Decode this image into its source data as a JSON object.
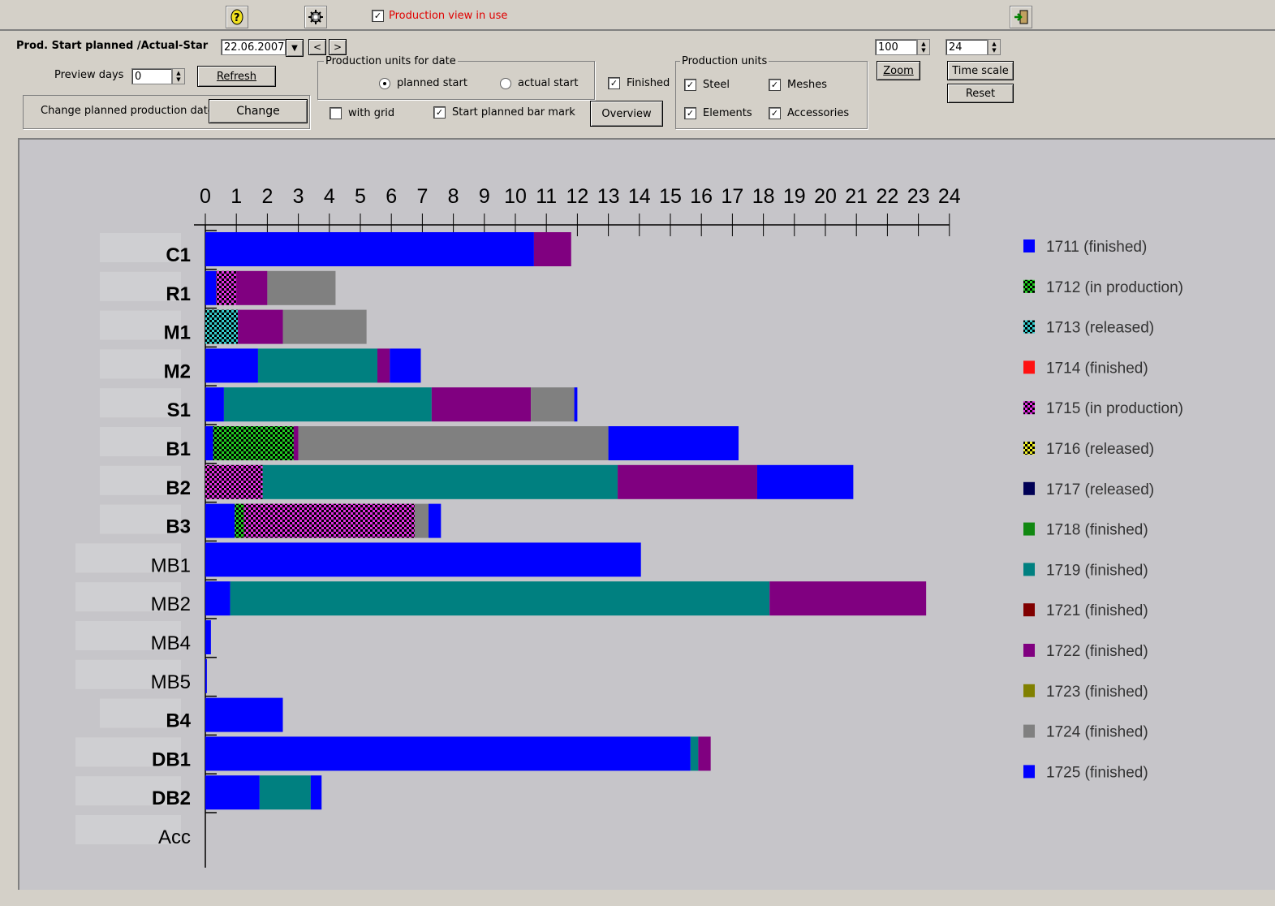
{
  "toolbar": {
    "production_view_label": "Production view in use",
    "production_view_checked": true
  },
  "controls": {
    "prod_start_label": "Prod. Start planned /Actual-Star",
    "date_value": "22.06.2007",
    "prev_label": "<",
    "next_label": ">",
    "preview_days_label": "Preview days",
    "preview_days_value": "0",
    "refresh_label": "Refresh",
    "change_date_label": "Change planned production date",
    "change_label": "Change",
    "prod_units_for_date_title": "Production units for date",
    "planned_start_label": "planned start",
    "actual_start_label": "actual start",
    "finished_label": "Finished",
    "with_grid_label": "with grid",
    "start_planned_bar_mark_label": "Start planned bar mark",
    "overview_label": "Overview",
    "prod_units_title": "Production units",
    "steel_label": "Steel",
    "meshes_label": "Meshes",
    "elements_label": "Elements",
    "accessories_label": "Accessories",
    "zoom_value": "100",
    "zoom_label": "Zoom",
    "time_scale_value": "24",
    "time_scale_label": "Time scale",
    "reset_label": "Reset"
  },
  "colors": {
    "1711": "#0000ff",
    "1712": "#22cc22",
    "1713": "#33cccc",
    "1714": "#ff1111",
    "1715": "#e030e0",
    "1716": "#eeee22",
    "1717": "#000055",
    "1718": "#118811",
    "1719": "#008080",
    "1721": "#800000",
    "1722": "#800080",
    "1723": "#808000",
    "1724": "#808080",
    "1725": "#0000ff"
  },
  "chart_data": {
    "type": "bar",
    "x_ticks": [
      "0",
      "1",
      "2",
      "3",
      "4",
      "5",
      "6",
      "7",
      "8",
      "9",
      "10",
      "11",
      "12",
      "13",
      "14",
      "15",
      "16",
      "17",
      "18",
      "19",
      "20",
      "21",
      "22",
      "23",
      "24"
    ],
    "xlim": [
      0,
      24
    ],
    "categories": [
      "C1",
      "R1",
      "M1",
      "M2",
      "S1",
      "B1",
      "B2",
      "B3",
      "MB1",
      "MB2",
      "MB4",
      "MB5",
      "B4",
      "DB1",
      "DB2",
      "Acc"
    ],
    "bold_categories": [
      "C1",
      "R1",
      "M1",
      "M2",
      "S1",
      "B1",
      "B2",
      "B3",
      "B4",
      "DB1",
      "DB2"
    ],
    "rows": [
      {
        "label": "C1",
        "segments": [
          {
            "o": "1711",
            "s": 0,
            "e": 10.6
          },
          {
            "o": "1722",
            "s": 10.6,
            "e": 11.8
          }
        ]
      },
      {
        "label": "R1",
        "segments": [
          {
            "o": "1711",
            "s": 0,
            "e": 0.35
          },
          {
            "o": "1715",
            "s": 0.35,
            "e": 1.0,
            "pattern": true
          },
          {
            "o": "1722",
            "s": 1.0,
            "e": 2.0
          },
          {
            "o": "1724",
            "s": 2.0,
            "e": 4.2
          }
        ]
      },
      {
        "label": "M1",
        "segments": [
          {
            "o": "1713",
            "s": 0,
            "e": 1.05,
            "pattern": true
          },
          {
            "o": "1722",
            "s": 1.05,
            "e": 2.5
          },
          {
            "o": "1724",
            "s": 2.5,
            "e": 5.2
          }
        ]
      },
      {
        "label": "M2",
        "segments": [
          {
            "o": "1711",
            "s": 0,
            "e": 1.7
          },
          {
            "o": "1719",
            "s": 1.7,
            "e": 5.55
          },
          {
            "o": "1722",
            "s": 5.55,
            "e": 5.95
          },
          {
            "o": "1725",
            "s": 5.95,
            "e": 6.95
          }
        ]
      },
      {
        "label": "S1",
        "segments": [
          {
            "o": "1711",
            "s": 0,
            "e": 0.6
          },
          {
            "o": "1719",
            "s": 0.6,
            "e": 7.3
          },
          {
            "o": "1722",
            "s": 7.3,
            "e": 10.5
          },
          {
            "o": "1724",
            "s": 10.5,
            "e": 11.9
          },
          {
            "o": "1725",
            "s": 11.9,
            "e": 12.0
          }
        ]
      },
      {
        "label": "B1",
        "segments": [
          {
            "o": "1711",
            "s": 0,
            "e": 0.25
          },
          {
            "o": "1712",
            "s": 0.25,
            "e": 2.85,
            "pattern": true
          },
          {
            "o": "1722",
            "s": 2.85,
            "e": 3.0
          },
          {
            "o": "1724",
            "s": 3.0,
            "e": 13.0
          },
          {
            "o": "1725",
            "s": 13.0,
            "e": 17.2
          }
        ]
      },
      {
        "label": "B2",
        "segments": [
          {
            "o": "1715",
            "s": 0,
            "e": 1.85,
            "pattern": true
          },
          {
            "o": "1719",
            "s": 1.85,
            "e": 13.3
          },
          {
            "o": "1722",
            "s": 13.3,
            "e": 17.8
          },
          {
            "o": "1725",
            "s": 17.8,
            "e": 20.9
          }
        ]
      },
      {
        "label": "B3",
        "segments": [
          {
            "o": "1711",
            "s": 0,
            "e": 0.95
          },
          {
            "o": "1712",
            "s": 0.95,
            "e": 1.25,
            "pattern": true
          },
          {
            "o": "1715",
            "s": 1.25,
            "e": 6.75,
            "pattern": true
          },
          {
            "o": "1724",
            "s": 6.75,
            "e": 7.2
          },
          {
            "o": "1725",
            "s": 7.2,
            "e": 7.6
          }
        ]
      },
      {
        "label": "MB1",
        "segments": [
          {
            "o": "1711",
            "s": 0,
            "e": 14.05
          }
        ]
      },
      {
        "label": "MB2",
        "segments": [
          {
            "o": "1711",
            "s": 0,
            "e": 0.8
          },
          {
            "o": "1719",
            "s": 0.8,
            "e": 18.2
          },
          {
            "o": "1722",
            "s": 18.2,
            "e": 23.25
          }
        ]
      },
      {
        "label": "MB4",
        "segments": [
          {
            "o": "1711",
            "s": 0,
            "e": 0.18
          }
        ]
      },
      {
        "label": "MB5",
        "segments": [
          {
            "o": "1711",
            "s": 0,
            "e": 0.05
          }
        ]
      },
      {
        "label": "B4",
        "segments": [
          {
            "o": "1711",
            "s": 0,
            "e": 2.5
          }
        ]
      },
      {
        "label": "DB1",
        "segments": [
          {
            "o": "1711",
            "s": 0,
            "e": 15.65
          },
          {
            "o": "1719",
            "s": 15.65,
            "e": 15.9
          },
          {
            "o": "1722",
            "s": 15.9,
            "e": 16.3
          }
        ]
      },
      {
        "label": "DB2",
        "segments": [
          {
            "o": "1711",
            "s": 0,
            "e": 1.75
          },
          {
            "o": "1719",
            "s": 1.75,
            "e": 3.4
          },
          {
            "o": "1725",
            "s": 3.4,
            "e": 3.75
          }
        ]
      },
      {
        "label": "Acc",
        "segments": []
      }
    ],
    "legend": [
      {
        "order": "1711",
        "status": "(finished)",
        "pattern": false
      },
      {
        "order": "1712",
        "status": "(in production)",
        "pattern": true
      },
      {
        "order": "1713",
        "status": "(released)",
        "pattern": true
      },
      {
        "order": "1714",
        "status": "(finished)",
        "pattern": false
      },
      {
        "order": "1715",
        "status": "(in production)",
        "pattern": true
      },
      {
        "order": "1716",
        "status": "(released)",
        "pattern": true
      },
      {
        "order": "1717",
        "status": "(released)",
        "pattern": false
      },
      {
        "order": "1718",
        "status": "(finished)",
        "pattern": false
      },
      {
        "order": "1719",
        "status": "(finished)",
        "pattern": false
      },
      {
        "order": "1721",
        "status": "(finished)",
        "pattern": false
      },
      {
        "order": "1722",
        "status": "(finished)",
        "pattern": false
      },
      {
        "order": "1723",
        "status": "(finished)",
        "pattern": false
      },
      {
        "order": "1724",
        "status": "(finished)",
        "pattern": false
      },
      {
        "order": "1725",
        "status": "(finished)",
        "pattern": false
      }
    ]
  }
}
